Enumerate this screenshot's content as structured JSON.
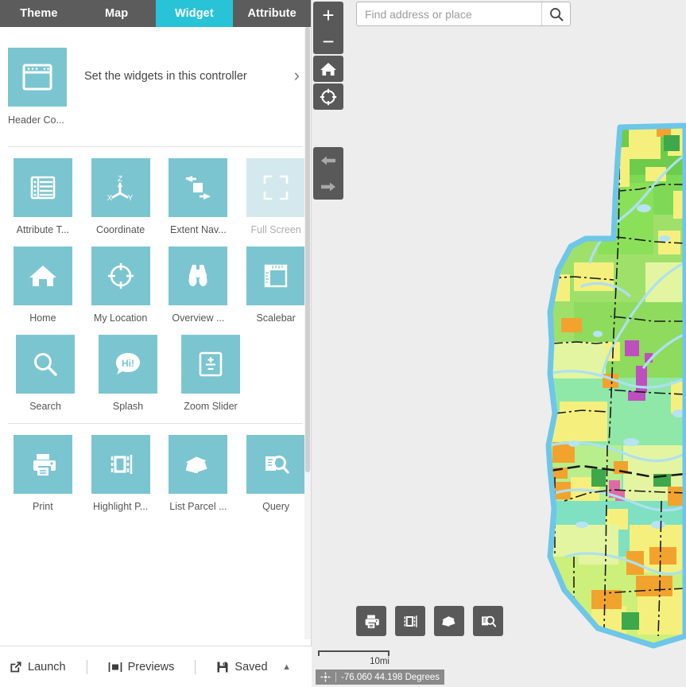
{
  "tabs": [
    {
      "label": "Theme",
      "active": false,
      "name": "tab-theme"
    },
    {
      "label": "Map",
      "active": false,
      "name": "tab-map"
    },
    {
      "label": "Widget",
      "active": true,
      "name": "tab-widget"
    },
    {
      "label": "Attribute",
      "active": false,
      "name": "tab-attribute"
    }
  ],
  "header_controller": {
    "label": "Header Co...",
    "description": "Set the widgets in this controller",
    "chevron": "›",
    "icon": "window-icon"
  },
  "widgets": [
    [
      {
        "label": "Attribute T...",
        "icon": "attribute-table-icon",
        "disabled": false
      },
      {
        "label": "Coordinate",
        "icon": "coordinate-axes-icon",
        "disabled": false
      },
      {
        "label": "Extent Nav...",
        "icon": "extent-navigate-icon",
        "disabled": false
      },
      {
        "label": "Full Screen",
        "icon": "full-screen-icon",
        "disabled": true
      }
    ],
    [
      {
        "label": "Home",
        "icon": "home-icon",
        "disabled": false
      },
      {
        "label": "My Location",
        "icon": "my-location-icon",
        "disabled": false
      },
      {
        "label": "Overview ...",
        "icon": "binoculars-icon",
        "disabled": false
      },
      {
        "label": "Scalebar",
        "icon": "scalebar-ruler-icon",
        "disabled": false
      }
    ],
    [
      {
        "label": "Search",
        "icon": "search-icon",
        "disabled": false
      },
      {
        "label": "Splash",
        "icon": "splash-hi-icon",
        "disabled": false
      },
      {
        "label": "Zoom Slider",
        "icon": "zoom-slider-icon",
        "disabled": false
      }
    ],
    [
      {
        "label": "Print",
        "icon": "printer-icon",
        "disabled": false
      },
      {
        "label": "Highlight P...",
        "icon": "highlight-parcel-icon",
        "disabled": false
      },
      {
        "label": "List Parcel ...",
        "icon": "list-parcel-icon",
        "disabled": false
      },
      {
        "label": "Query",
        "icon": "query-icon",
        "disabled": false
      }
    ]
  ],
  "bottom_bar": {
    "launch": "Launch",
    "previews": "Previews",
    "saved": "Saved",
    "caret": "▲"
  },
  "map": {
    "search_placeholder": "Find address or place",
    "search_value": "",
    "scalebar_label": "10mi",
    "coordinates": "-76.060 44.198 Degrees",
    "controls": {
      "zoom_in": "+",
      "zoom_out": "−",
      "home": "home-icon",
      "locate": "my-location-icon",
      "prev_extent": "arrow-left-icon",
      "next_extent": "arrow-right-icon"
    },
    "toolbar": [
      {
        "icon": "printer-icon",
        "name": "map-print-button"
      },
      {
        "icon": "highlight-parcel-icon",
        "name": "map-highlight-parcel-button"
      },
      {
        "icon": "list-parcel-icon",
        "name": "map-list-parcel-button"
      },
      {
        "icon": "query-icon",
        "name": "map-query-button"
      }
    ]
  },
  "colors": {
    "accent": "#29c3d8",
    "tile": "#7bc5d0",
    "tile_disabled": "#d3e9ee",
    "tabbar": "#5c5c5c",
    "map_control": "#595959",
    "map_background": "#ededed",
    "boundary": "#6ec6e8"
  }
}
